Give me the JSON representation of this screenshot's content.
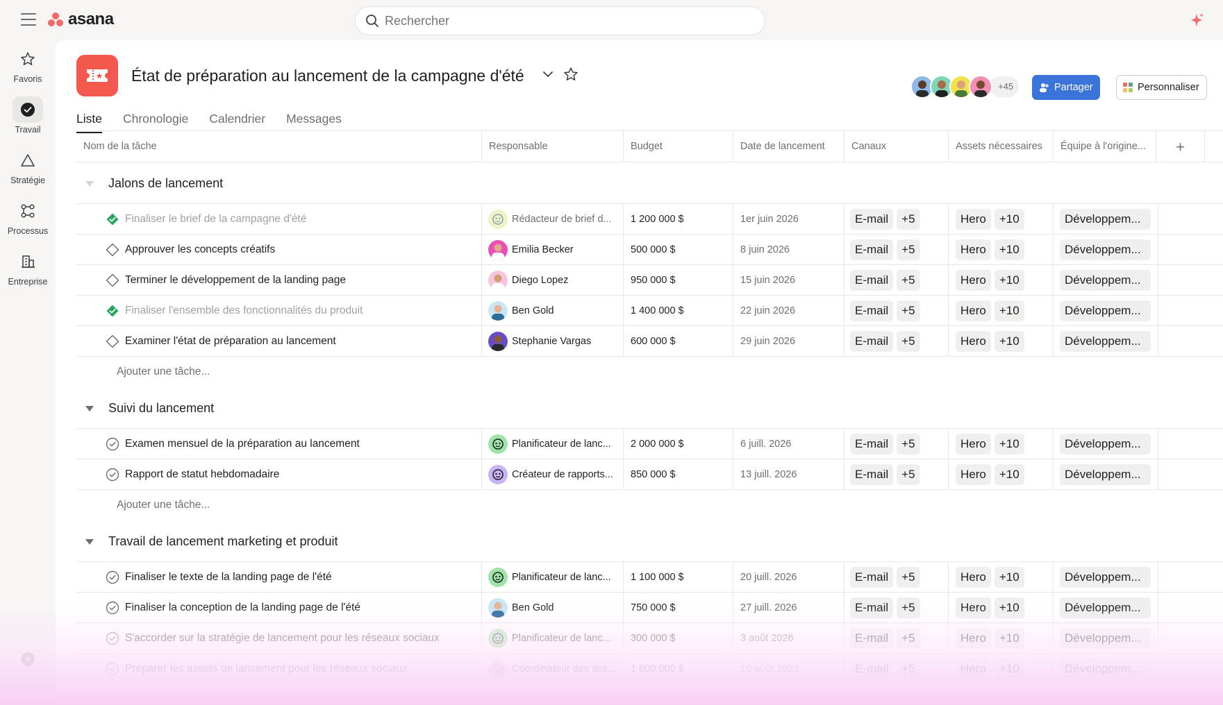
{
  "app": {
    "logo_text": "asana",
    "brand_color": "#f06a6a",
    "accent_color": "#3b74d8"
  },
  "search": {
    "placeholder": "Rechercher"
  },
  "sidebar": {
    "items": [
      {
        "label": "Favoris",
        "icon": "star-icon"
      },
      {
        "label": "Travail",
        "icon": "check-circle-icon",
        "active": true
      },
      {
        "label": "Stratégie",
        "icon": "triangle-icon"
      },
      {
        "label": "Processus",
        "icon": "workflow-icon"
      },
      {
        "label": "Entreprise",
        "icon": "building-icon"
      }
    ]
  },
  "project": {
    "title": "État de préparation au lancement de la campagne d'été",
    "tabs": [
      "Liste",
      "Chronologie",
      "Calendrier",
      "Messages"
    ],
    "active_tab": "Liste",
    "members_extra": "+45",
    "share_label": "Partager",
    "customize_label": "Personnaliser"
  },
  "columns": [
    "Nom de la tâche",
    "Responsable",
    "Budget",
    "Date de lancement",
    "Canaux",
    "Assets nécessaires",
    "Équipe à l'origine..."
  ],
  "sections": [
    {
      "title": "Jalons de lancement",
      "add_task": "Ajouter une tâche...",
      "tasks": [
        {
          "name": "Finaliser le brief de la campagne d'été",
          "assignee": "Rédacteur de brief d...",
          "budget": "1 200 000 $",
          "date": "1er juin 2026",
          "channel": "E-mail",
          "channel_more": "+5",
          "asset": "Hero",
          "asset_more": "+10",
          "team": "Développem..."
        },
        {
          "name": "Approuver les concepts créatifs",
          "assignee": "Emilia Becker",
          "budget": "500 000 $",
          "date": "8 juin 2026",
          "channel": "E-mail",
          "channel_more": "+5",
          "asset": "Hero",
          "asset_more": "+10",
          "team": "Développem..."
        },
        {
          "name": "Terminer le développement de la landing page",
          "assignee": "Diego Lopez",
          "budget": "950 000 $",
          "date": "15 juin 2026",
          "channel": "E-mail",
          "channel_more": "+5",
          "asset": "Hero",
          "asset_more": "+10",
          "team": "Développem..."
        },
        {
          "name": "Finaliser l'ensemble des fonctionnalités du produit",
          "assignee": "Ben Gold",
          "budget": "1 400 000 $",
          "date": "22 juin 2026",
          "channel": "E-mail",
          "channel_more": "+5",
          "asset": "Hero",
          "asset_more": "+10",
          "team": "Développem..."
        },
        {
          "name": "Examiner l'état de préparation au lancement",
          "assignee": "Stephanie Vargas",
          "budget": "600 000 $",
          "date": "29 juin 2026",
          "channel": "E-mail",
          "channel_more": "+5",
          "asset": "Hero",
          "asset_more": "+10",
          "team": "Développem..."
        }
      ]
    },
    {
      "title": "Suivi du lancement",
      "add_task": "Ajouter une tâche...",
      "tasks": [
        {
          "name": "Examen mensuel de la préparation au lancement",
          "assignee": "Planificateur de lanc...",
          "budget": "2 000 000 $",
          "date": "6 juill. 2026",
          "channel": "E-mail",
          "channel_more": "+5",
          "asset": "Hero",
          "asset_more": "+10",
          "team": "Développem..."
        },
        {
          "name": "Rapport de statut hebdomadaire",
          "assignee": "Créateur de rapports...",
          "budget": "850 000 $",
          "date": "13 juill. 2026",
          "channel": "E-mail",
          "channel_more": "+5",
          "asset": "Hero",
          "asset_more": "+10",
          "team": "Développem..."
        }
      ]
    },
    {
      "title": "Travail de lancement marketing et produit",
      "tasks": [
        {
          "name": "Finaliser le texte de la landing page de l'été",
          "assignee": "Planificateur de lanc...",
          "budget": "1 100 000 $",
          "date": "20 juill. 2026",
          "channel": "E-mail",
          "channel_more": "+5",
          "asset": "Hero",
          "asset_more": "+10",
          "team": "Développem..."
        },
        {
          "name": "Finaliser la conception de la landing page de l'été",
          "assignee": "Ben Gold",
          "budget": "750 000 $",
          "date": "27 juill. 2026",
          "channel": "E-mail",
          "channel_more": "+5",
          "asset": "Hero",
          "asset_more": "+10",
          "team": "Développem..."
        },
        {
          "name": "S'accorder sur la stratégie de lancement pour les réseaux sociaux",
          "assignee": "Planificateur de lanc...",
          "budget": "300 000 $",
          "date": "3 août 2026",
          "channel": "E-mail",
          "channel_more": "+5",
          "asset": "Hero",
          "asset_more": "+10",
          "team": "Développem..."
        },
        {
          "name": "Préparer les assets de lancement pour les réseaux sociaux",
          "assignee": "Coordinateur des ass...",
          "budget": "1 600 000 $",
          "date": "10 août 2026",
          "channel": "E-mail",
          "channel_more": "+5",
          "asset": "Hero",
          "asset_more": "+10",
          "team": "Développem..."
        }
      ]
    }
  ]
}
